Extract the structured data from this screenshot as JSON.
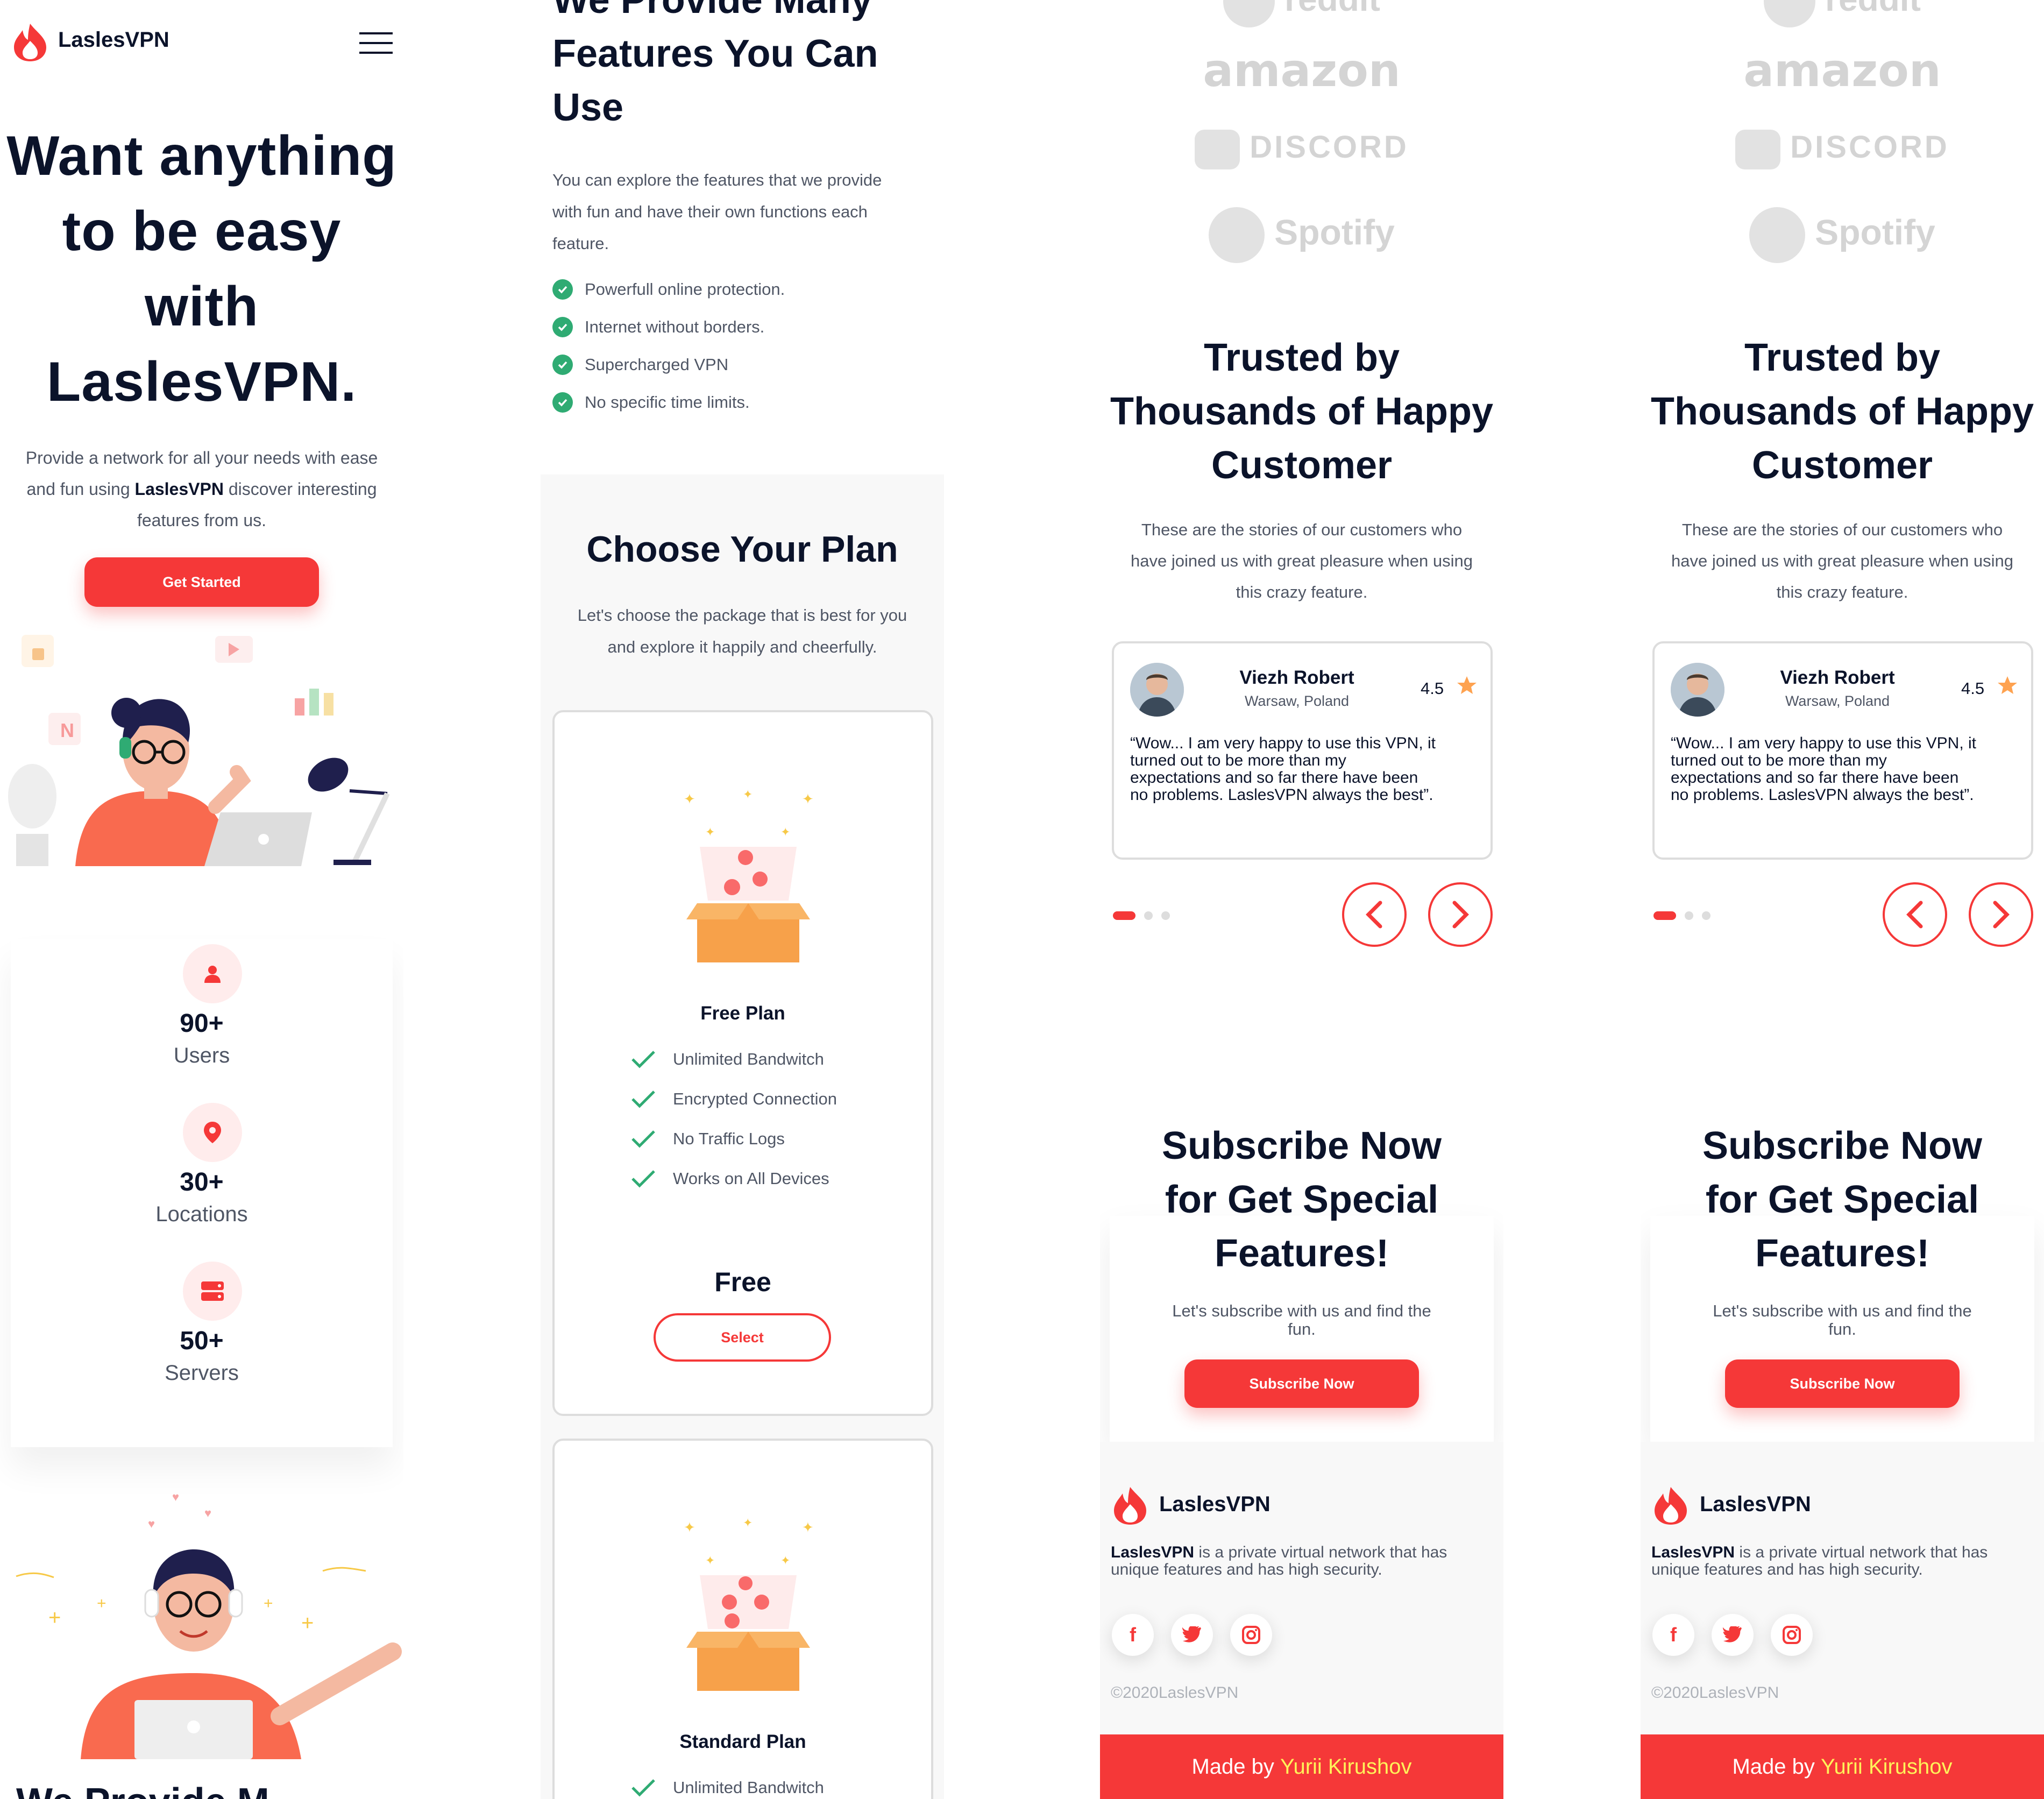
{
  "brand": {
    "name": "LaslesVPN",
    "accent": "#f53838",
    "dark": "#0b132a",
    "muted": "#4f5665",
    "success": "#2fab73"
  },
  "nav": {
    "menu_icon": "hamburger-menu-icon"
  },
  "hero": {
    "title_lines": [
      "Want anything",
      "to be easy",
      "with",
      "LaslesVPN."
    ],
    "desc_line1": "Provide a network for all your needs with ease",
    "desc_line2_pre": "and fun using ",
    "desc_line2_brand": "LaslesVPN",
    "desc_line2_post": " discover interesting",
    "desc_line3": "features from us.",
    "cta": "Get Started"
  },
  "stats": [
    {
      "value": "90+",
      "label": "Users",
      "icon": "user-icon"
    },
    {
      "value": "30+",
      "label": "Locations",
      "icon": "location-pin-icon"
    },
    {
      "value": "50+",
      "label": "Servers",
      "icon": "server-icon"
    }
  ],
  "features_section": {
    "title_lines": [
      "We Provide Many",
      "Features You Can",
      "Use"
    ],
    "cut_heading": "We Provide M",
    "desc_lines": [
      "You can explore the features that we provide",
      "with fun and have their own functions each",
      "feature."
    ],
    "items": [
      "Powerfull online protection.",
      "Internet without borders.",
      "Supercharged VPN",
      "No specific time limits."
    ]
  },
  "plans_section": {
    "title": "Choose Your Plan",
    "desc_lines": [
      "Let's choose the package that is best for you",
      "and explore it happily and cheerfully."
    ],
    "plans": [
      {
        "name": "Free Plan",
        "features": [
          "Unlimited Bandwitch",
          "Encrypted Connection",
          "No Traffic Logs",
          "Works on All Devices"
        ],
        "price": "Free",
        "button": "Select"
      },
      {
        "name": "Standard Plan",
        "features": [
          "Unlimited Bandwitch"
        ]
      }
    ]
  },
  "partners": [
    "reddit",
    "amazon",
    "DISCORD",
    "Spotify"
  ],
  "testimonials_section": {
    "title_lines": [
      "Trusted by",
      "Thousands of Happy",
      "Customer"
    ],
    "desc_lines": [
      "These are the stories of our customers who",
      "have joined us with great pleasure when using",
      "this crazy feature."
    ],
    "review": {
      "name": "Viezh Robert",
      "location": "Warsaw, Poland",
      "rating": "4.5",
      "text_lines": [
        "“Wow... I am very happy to use this VPN, it",
        "turned out to be more than my",
        "expectations and so far there have been",
        "no problems. LaslesVPN always the best”."
      ]
    },
    "slide_count": 3,
    "active_slide": 1
  },
  "subscribe_section": {
    "title_lines": [
      "Subscribe Now",
      "for Get Special",
      "Features!"
    ],
    "desc_lines": [
      "Let's subscribe with us and find the",
      "fun."
    ],
    "button": "Subscribe Now"
  },
  "footer": {
    "brand": "LaslesVPN",
    "desc_brand": "LaslesVPN",
    "desc_line1_rest": " is a private virtual network that has",
    "desc_line2": "unique features and has high security.",
    "socials": [
      "facebook-icon",
      "twitter-icon",
      "instagram-icon"
    ],
    "copyright": "©2020LaslesVPN",
    "made_by_pre": "Made by ",
    "made_by_name": "Yurii Kirushov",
    "made_by_color": "#fff25a"
  }
}
